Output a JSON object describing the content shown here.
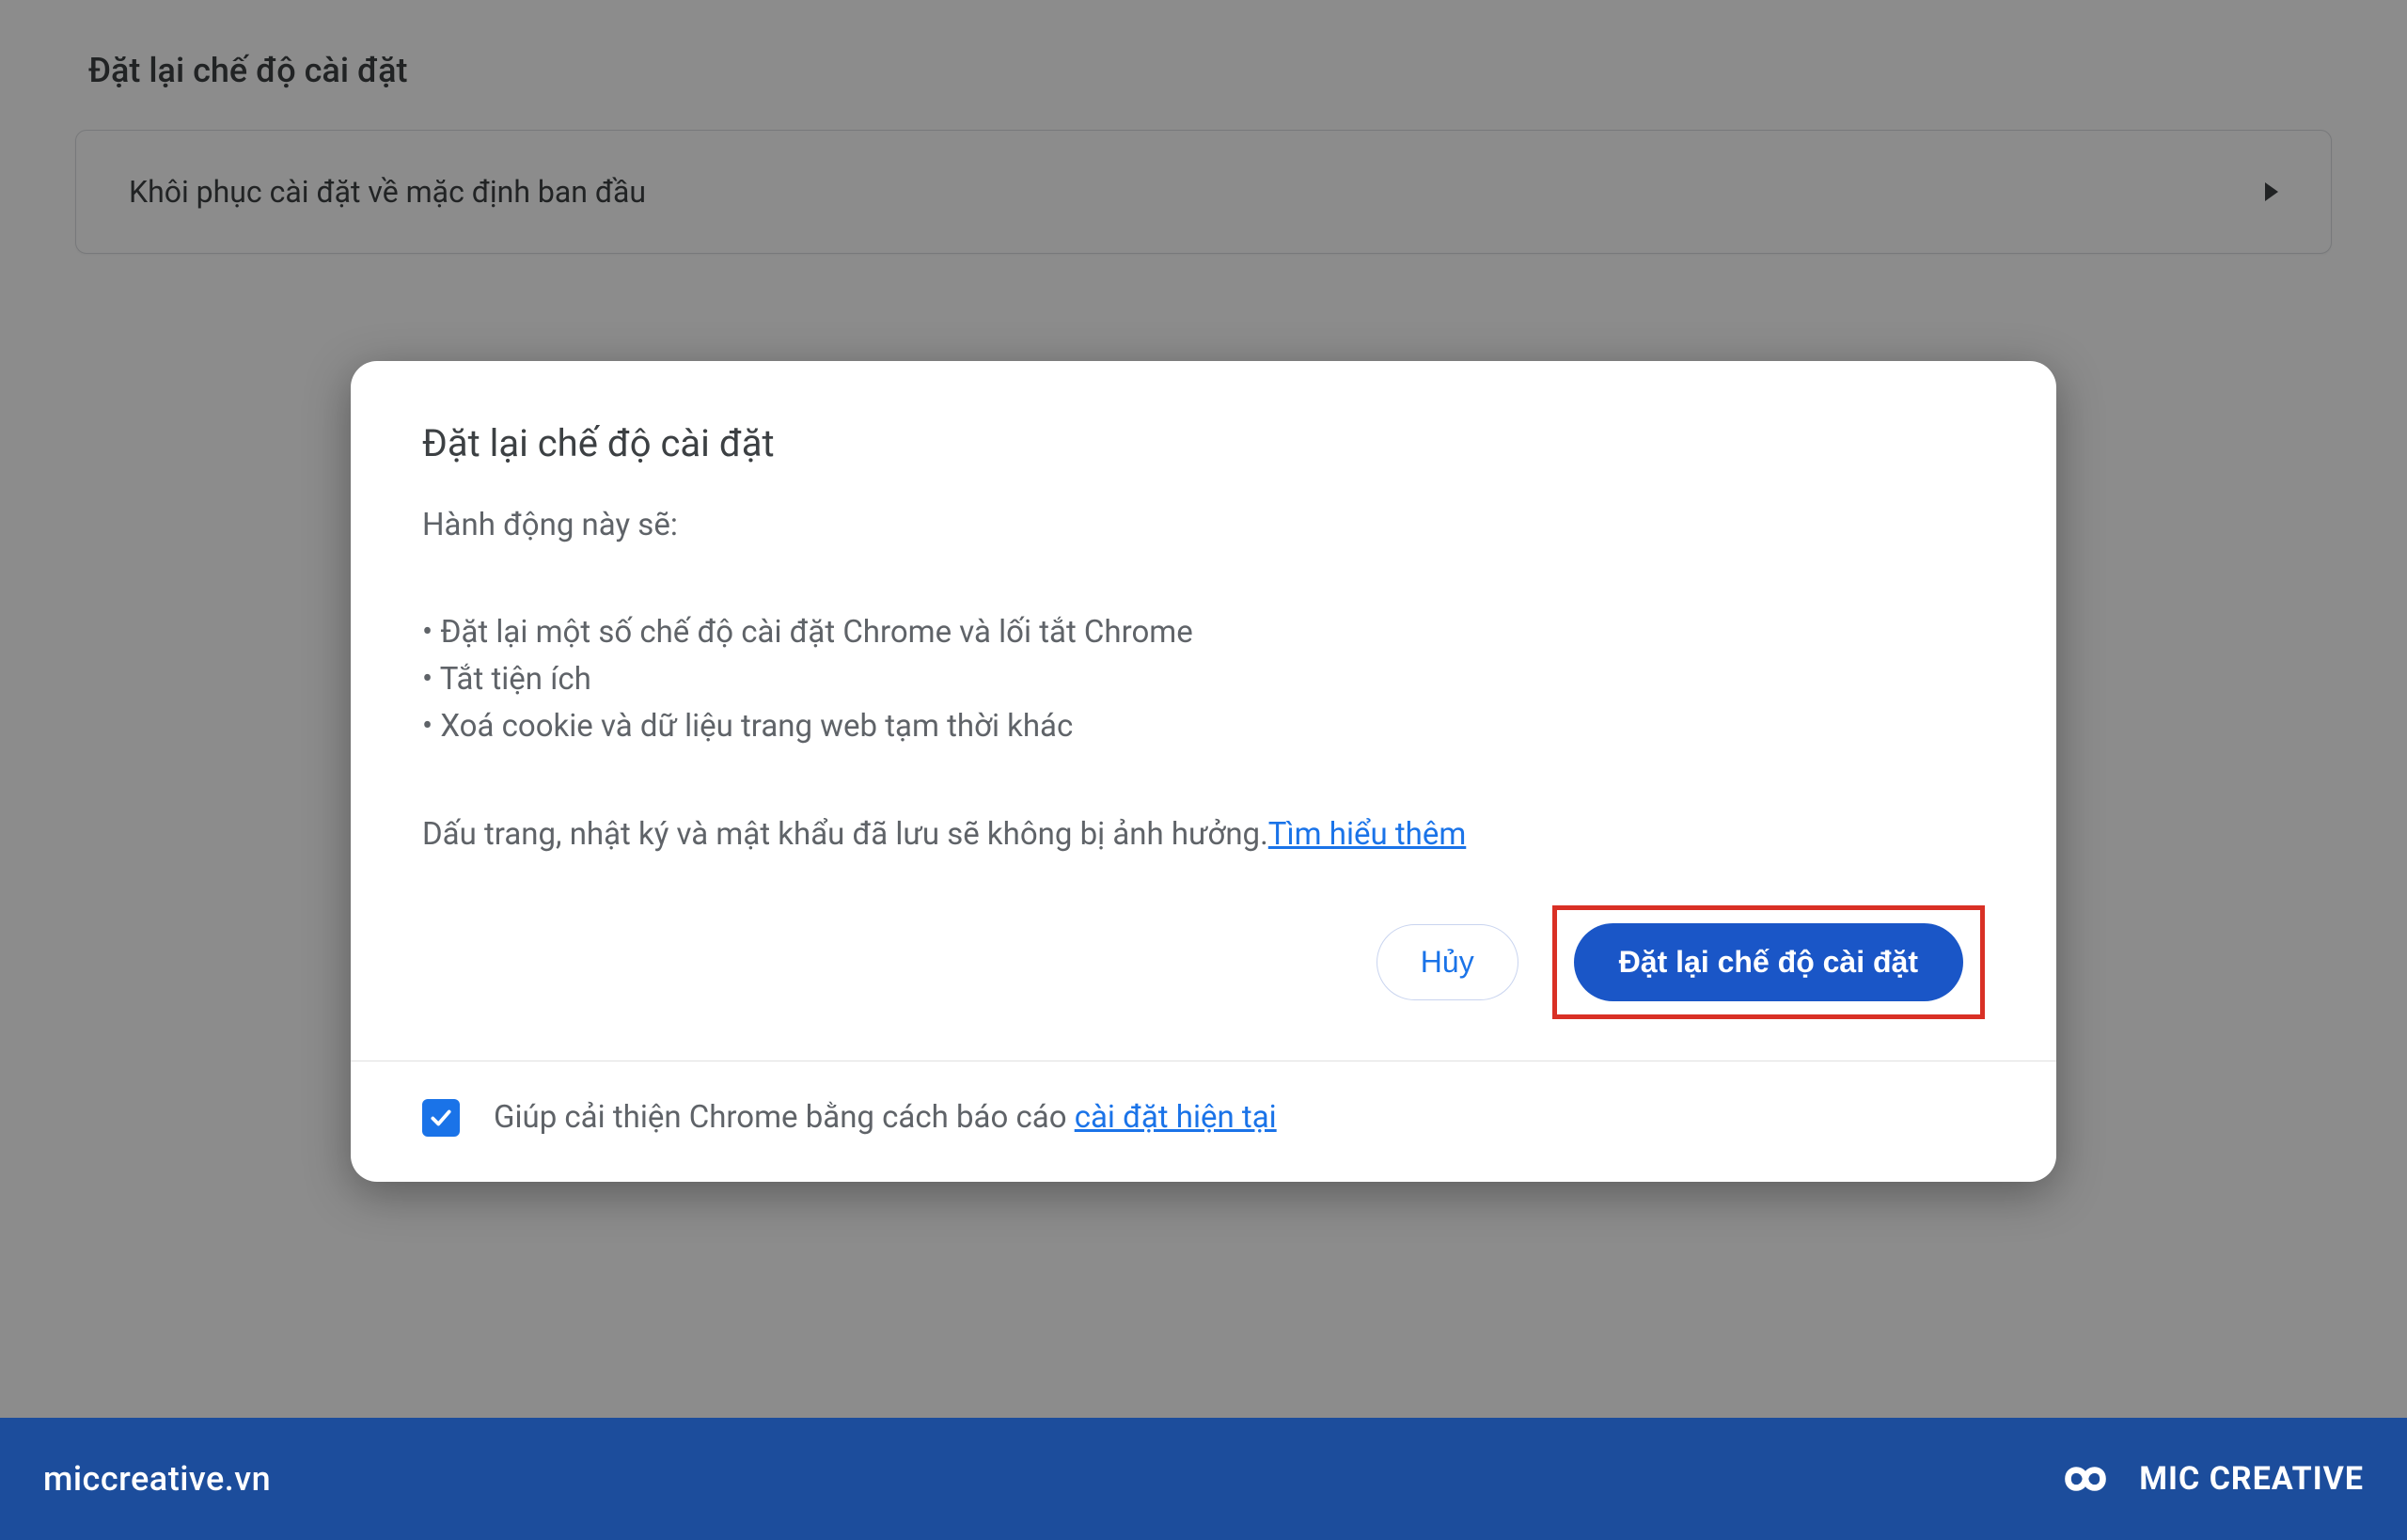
{
  "page": {
    "section_title": "Đặt lại chế độ cài đặt",
    "restore_default_label": "Khôi phục cài đặt về mặc định ban đầu"
  },
  "dialog": {
    "title": "Đặt lại chế độ cài đặt",
    "intro": "Hành động này sẽ:",
    "bullets": [
      "Đặt lại một số chế độ cài đặt Chrome và lối tắt Chrome",
      "Tắt tiện ích",
      "Xoá cookie và dữ liệu trang web tạm thời khác"
    ],
    "note_prefix": "Dấu trang, nhật ký và mật khẩu đã lưu sẽ không bị ảnh hưởng.",
    "learn_more": "Tìm hiểu thêm",
    "cancel_label": "Hủy",
    "confirm_label": "Đặt lại chế độ cài đặt",
    "report_checkbox_checked": true,
    "report_text_prefix": "Giúp cải thiện Chrome bằng cách báo cáo ",
    "report_link": "cài đặt hiện tại"
  },
  "brand": {
    "site": "miccreative.vn",
    "name": "MIC CREATIVE"
  },
  "colors": {
    "accent": "#1a73e8",
    "brand_bar": "#1c4d9c",
    "highlight": "#d93025"
  }
}
